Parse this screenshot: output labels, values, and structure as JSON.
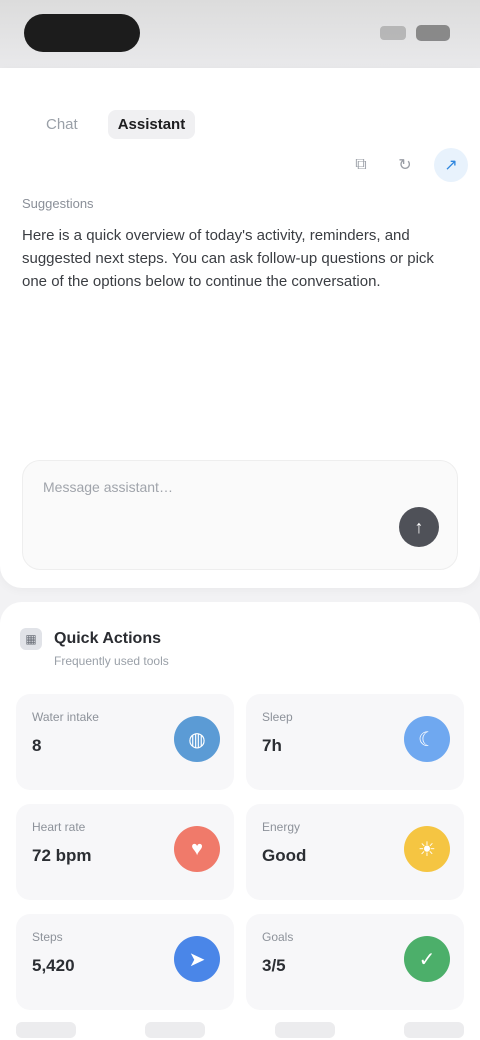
{
  "status_bar": {
    "time": ""
  },
  "tabs": [
    {
      "label": "Chat",
      "active": false
    },
    {
      "label": "Assistant",
      "active": true
    }
  ],
  "chat": {
    "subtitle": "Suggestions",
    "message": "Here is a quick overview of today's activity, reminders, and suggested next steps. You can ask follow-up questions or pick one of the options below to continue the conversation.",
    "composer_placeholder": "Message assistant…",
    "send_icon": "arrow-up"
  },
  "actions": [
    {
      "name": "copy-icon",
      "glyph": "⧉"
    },
    {
      "name": "refresh-icon",
      "glyph": "↻"
    },
    {
      "name": "share-icon",
      "glyph": "↗"
    }
  ],
  "section": {
    "title": "Quick Actions",
    "subtitle": "Frequently used tools",
    "tiles": [
      {
        "label": "Water intake",
        "value": "8",
        "color": "#5b9bd5",
        "icon": "drop-icon",
        "glyph": "◍"
      },
      {
        "label": "Sleep",
        "value": "7h",
        "color": "#6fa8f0",
        "icon": "moon-icon",
        "glyph": "☾"
      },
      {
        "label": "Heart rate",
        "value": "72 bpm",
        "color": "#f07a6a",
        "icon": "heart-icon",
        "glyph": "♥"
      },
      {
        "label": "Energy",
        "value": "Good",
        "color": "#f5c542",
        "icon": "sun-icon",
        "glyph": "☀"
      },
      {
        "label": "Steps",
        "value": "5,420",
        "color": "#4a86e8",
        "icon": "shoe-icon",
        "glyph": "➤"
      },
      {
        "label": "Goals",
        "value": "3/5",
        "color": "#4caf6a",
        "icon": "check-icon",
        "glyph": "✓"
      }
    ]
  }
}
